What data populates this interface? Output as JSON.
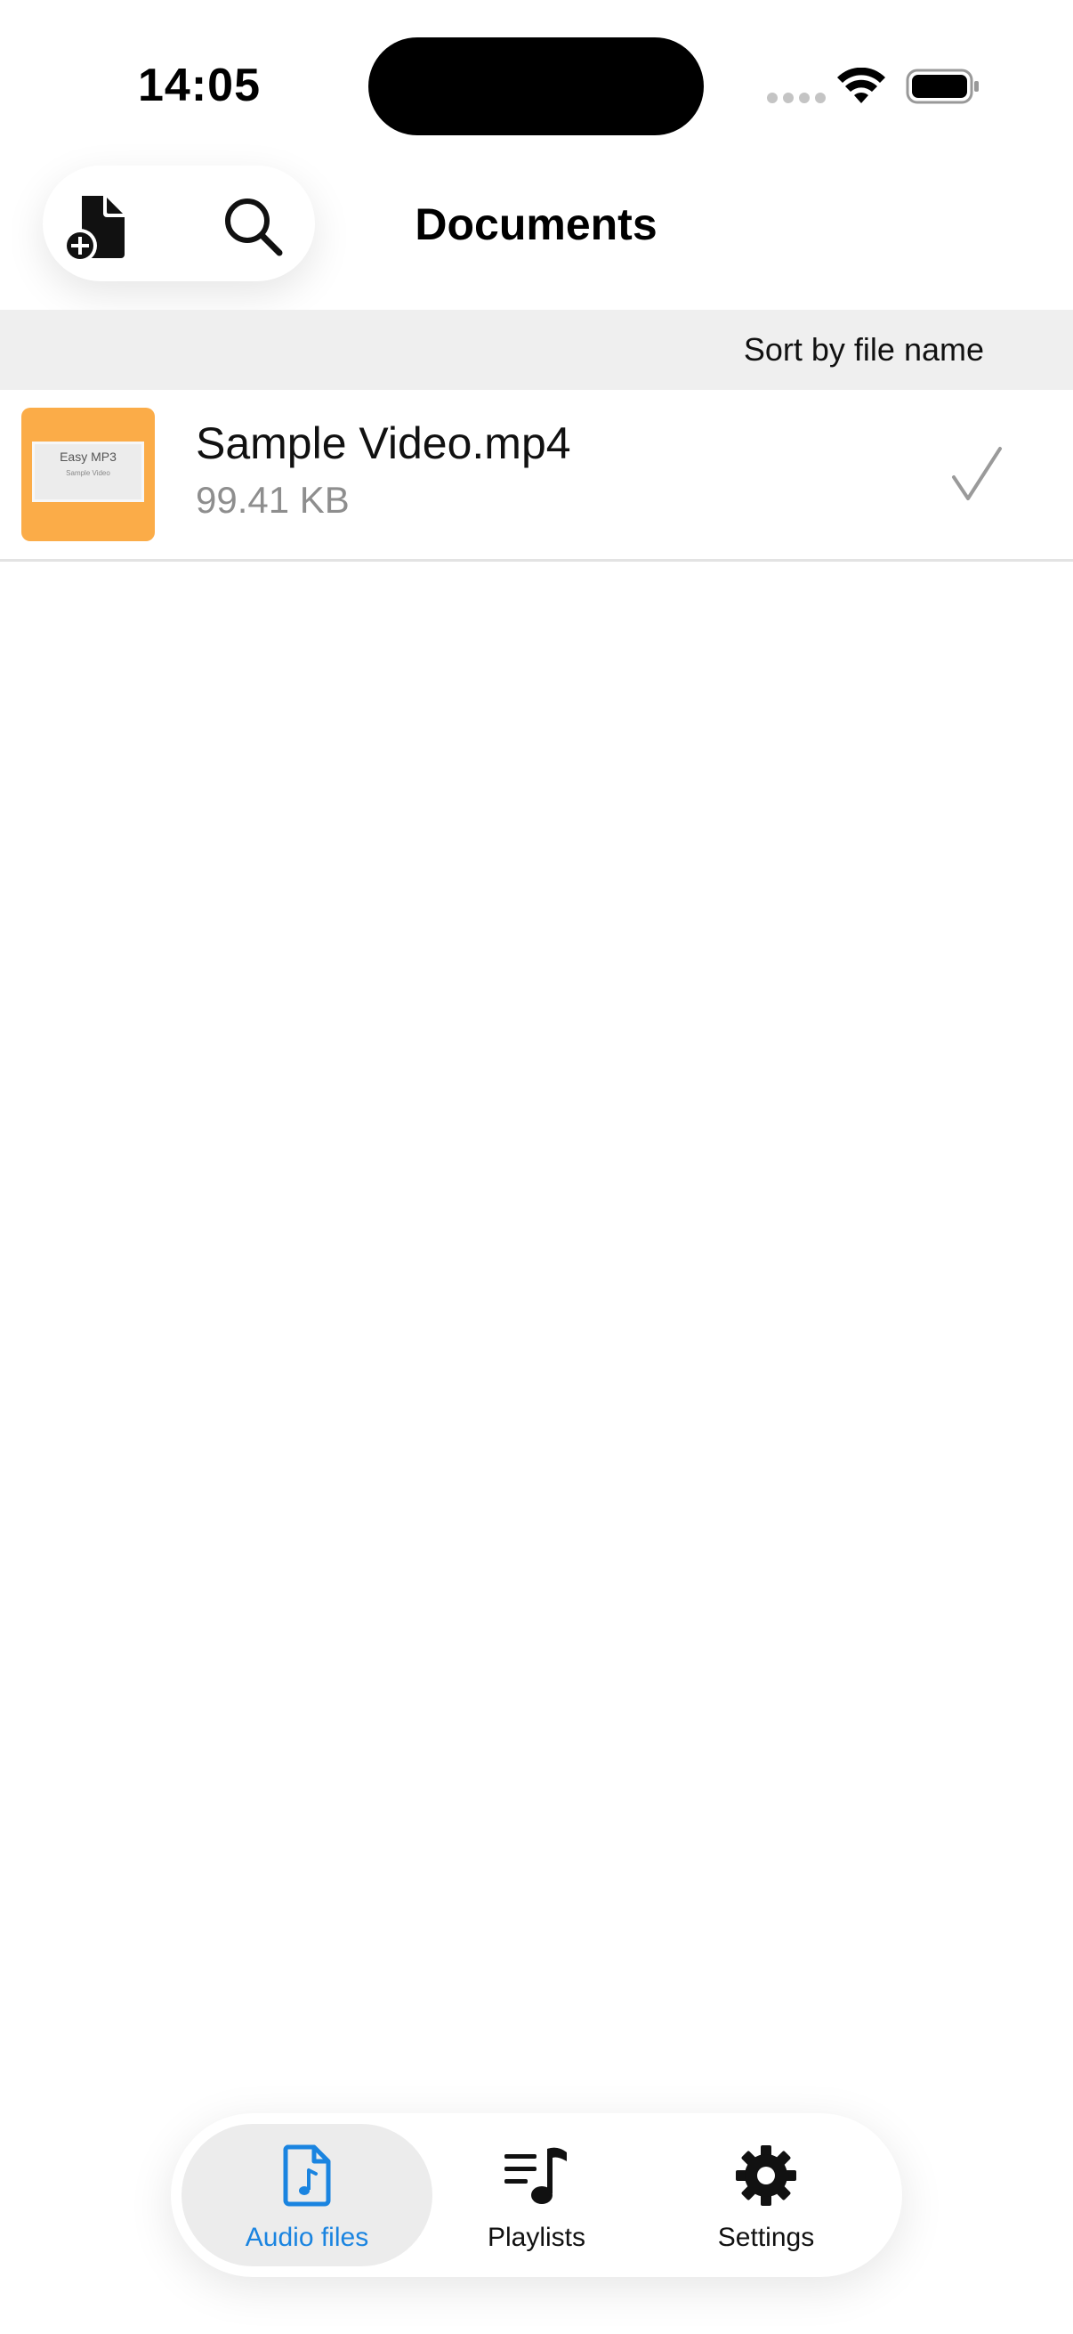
{
  "status_bar": {
    "time": "14:05"
  },
  "header": {
    "title": "Documents",
    "add_icon": "add-document-icon",
    "search_icon": "search-icon"
  },
  "sort": {
    "label": "Sort by file name"
  },
  "files": [
    {
      "name": "Sample Video.mp4",
      "size": "99.41 KB",
      "thumbnail": {
        "title": "Easy MP3",
        "subtitle": "Sample Video",
        "color": "#fbac48"
      },
      "selected": true
    }
  ],
  "tabs": [
    {
      "label": "Audio files",
      "icon": "music-file-icon",
      "active": true
    },
    {
      "label": "Playlists",
      "icon": "playlist-icon",
      "active": false
    },
    {
      "label": "Settings",
      "icon": "gear-icon",
      "active": false
    }
  ],
  "colors": {
    "accent": "#1a84e0",
    "thumbnail": "#fbac48",
    "sort_bar": "#efefef"
  }
}
